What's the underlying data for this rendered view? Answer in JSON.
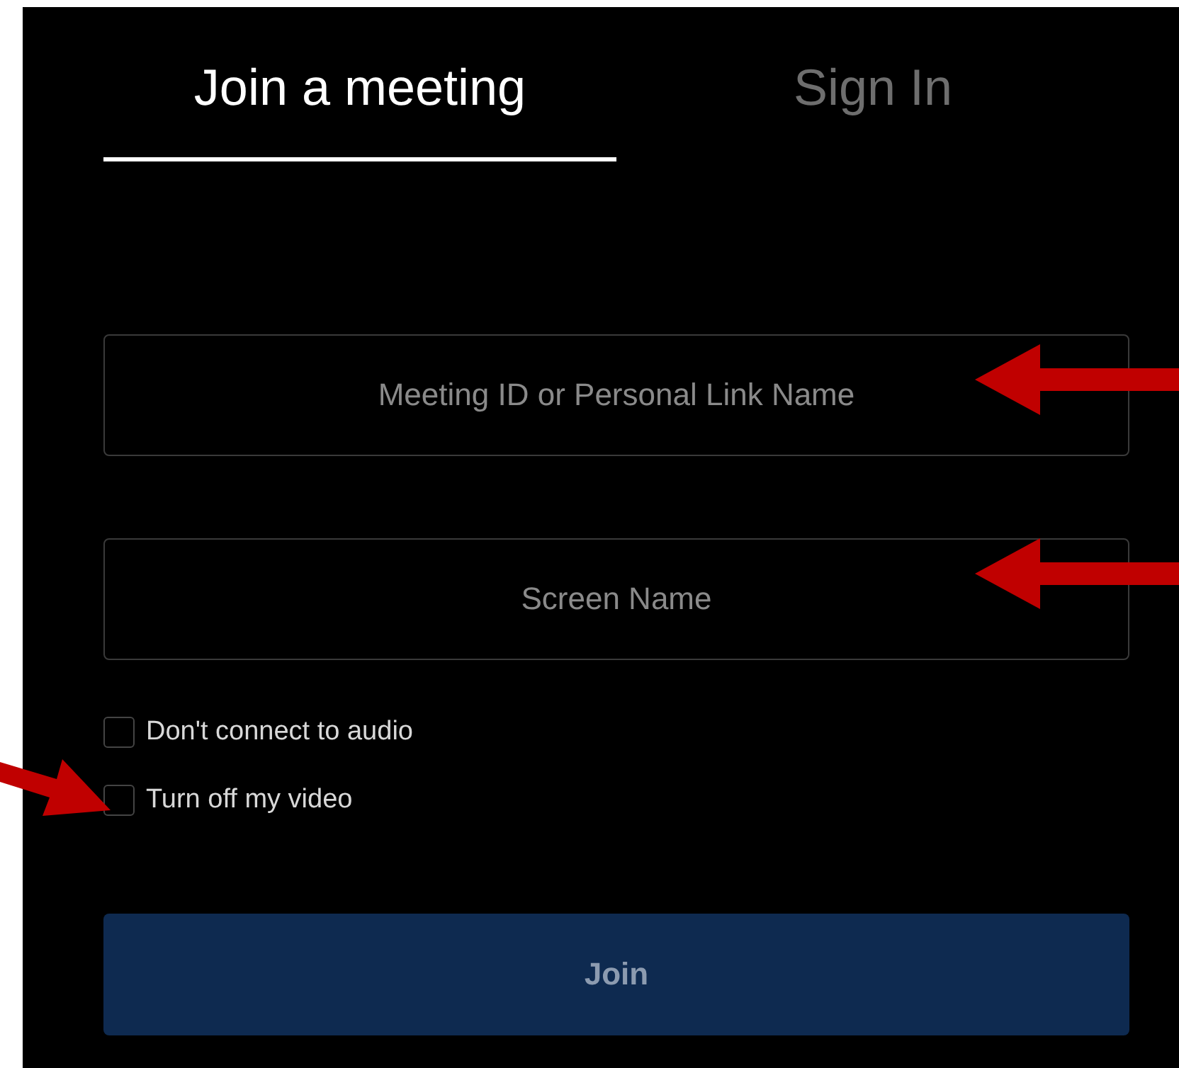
{
  "tabs": [
    {
      "label": "Join a meeting",
      "selected": true
    },
    {
      "label": "Sign In",
      "selected": false
    }
  ],
  "fields": [
    {
      "placeholder": "Meeting ID or Personal Link Name"
    },
    {
      "placeholder": "Screen Name"
    }
  ],
  "options": [
    {
      "label": "Don't connect to audio",
      "checked": false
    },
    {
      "label": "Turn off my video",
      "checked": false
    }
  ],
  "join_button": {
    "label": "Join"
  }
}
